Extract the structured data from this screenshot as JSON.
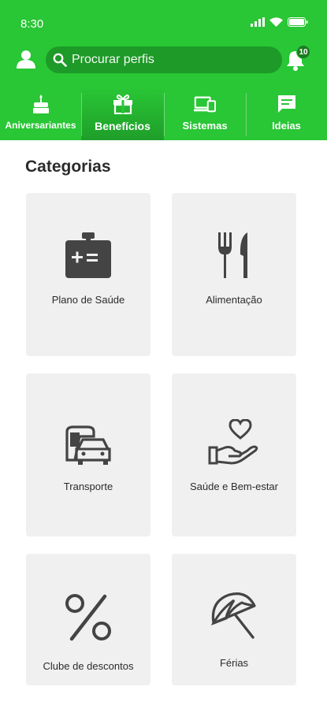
{
  "status_bar": {
    "time": "8:30"
  },
  "header": {
    "search": {
      "placeholder": "Procurar perfis"
    },
    "notifications_count": "10",
    "color": "#29c635"
  },
  "tabs": [
    {
      "label": "Aniversariantes",
      "icon": "birthday-cake-icon",
      "active": false
    },
    {
      "label": "Benefícios",
      "icon": "gift-icon",
      "active": true
    },
    {
      "label": "Sistemas",
      "icon": "devices-icon",
      "active": false
    },
    {
      "label": "Ideias",
      "icon": "chat-icon",
      "active": false
    }
  ],
  "main": {
    "title": "Categorias",
    "categories": [
      {
        "label": "Plano de Saúde",
        "icon": "health-card-icon"
      },
      {
        "label": "Alimentação",
        "icon": "fork-knife-icon"
      },
      {
        "label": "Transporte",
        "icon": "bus-car-icon"
      },
      {
        "label": "Saúde e Bem-estar",
        "icon": "heart-hand-icon"
      },
      {
        "label": "Clube de descontos",
        "icon": "percent-icon"
      },
      {
        "label": "Férias",
        "icon": "beach-umbrella-icon"
      }
    ]
  }
}
